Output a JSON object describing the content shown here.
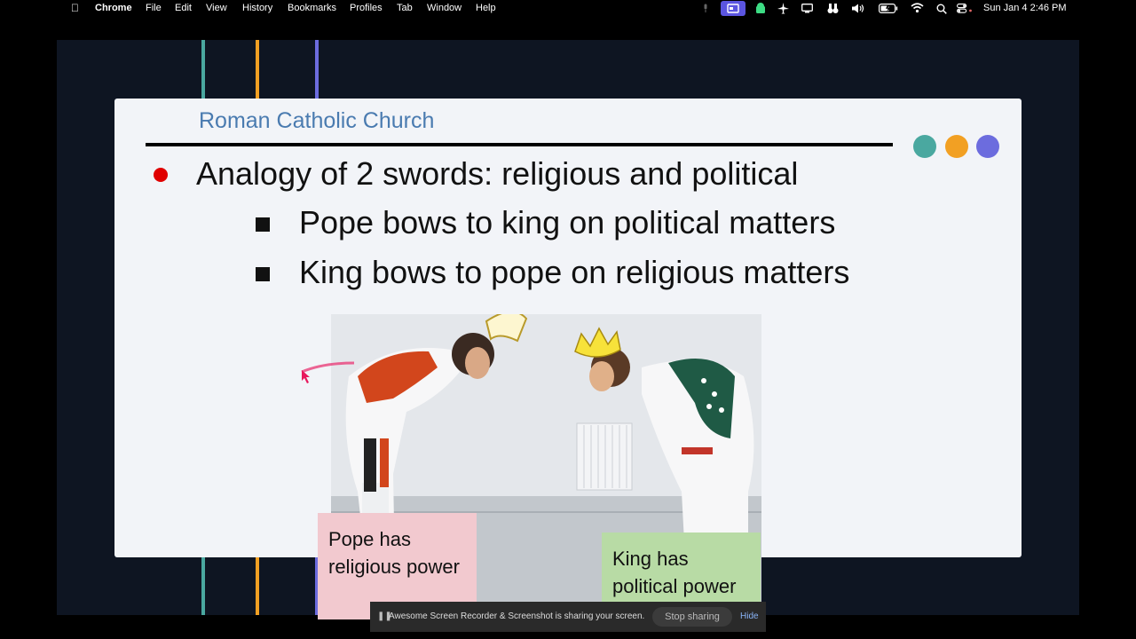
{
  "menubar": {
    "apple_icon": "apple-icon",
    "app_name": "Chrome",
    "menus": [
      "File",
      "Edit",
      "View",
      "History",
      "Bookmarks",
      "Profiles",
      "Tab",
      "Window",
      "Help"
    ],
    "clock": "Sun Jan 4  2:46 PM"
  },
  "slide": {
    "title": "Roman Catholic Church",
    "bullet": "Analogy of 2 swords: religious and political",
    "sub_bullets": [
      "Pope bows to king on political matters",
      "King bows to pope on religious matters"
    ],
    "dot_colors": [
      "#4aa8a0",
      "#f2a023",
      "#6c6cde"
    ],
    "note_pope": "Pope has religious power",
    "note_king": "King has political power",
    "note_pope_color": "#f2c9cf",
    "note_king_color": "#b8dba5"
  },
  "sharebar": {
    "message": "Awesome Screen Recorder & Screenshot is sharing your screen.",
    "stop_label": "Stop sharing",
    "hide_label": "Hide"
  },
  "colors": {
    "accent_teal": "#4aa8a0",
    "accent_orange": "#f2a023",
    "accent_purple": "#6c6cde"
  }
}
